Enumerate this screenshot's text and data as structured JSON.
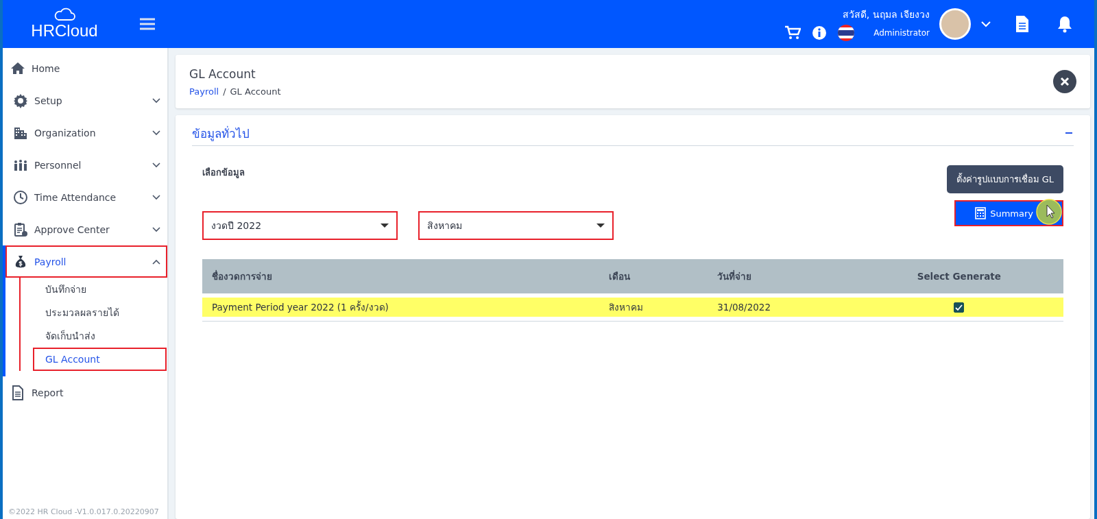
{
  "header": {
    "logo": "HRCloud",
    "greeting": "สวัสดี, นฤมล เจียงวง",
    "role": "Administrator"
  },
  "sidebar": {
    "items": [
      {
        "label": "Home",
        "kind": "link",
        "selected": false,
        "highlighted": false
      },
      {
        "label": "Setup",
        "kind": "group",
        "expanded": false,
        "selected": false,
        "highlighted": false
      },
      {
        "label": "Organization",
        "kind": "group",
        "expanded": false,
        "selected": false,
        "highlighted": false
      },
      {
        "label": "Personnel",
        "kind": "group",
        "expanded": false,
        "selected": false,
        "highlighted": false
      },
      {
        "label": "Time Attendance",
        "kind": "group",
        "expanded": false,
        "selected": false,
        "highlighted": false
      },
      {
        "label": "Approve Center",
        "kind": "group",
        "expanded": false,
        "selected": false,
        "highlighted": false
      },
      {
        "label": "Payroll",
        "kind": "group",
        "expanded": true,
        "selected": true,
        "highlighted": true,
        "children": [
          {
            "label": "บันทึกจ่าย",
            "selected": false,
            "highlighted": false
          },
          {
            "label": "ประมวลผลรายได้",
            "selected": false,
            "highlighted": false
          },
          {
            "label": "จัดเก็บนำส่ง",
            "selected": false,
            "highlighted": false
          },
          {
            "label": "GL Account",
            "selected": true,
            "highlighted": true
          }
        ]
      },
      {
        "label": "Report",
        "kind": "link",
        "selected": false,
        "highlighted": false
      }
    ],
    "footer": "©2022  HR Cloud  -V1.0.017.0.20220907"
  },
  "page": {
    "title": "GL Account",
    "breadcrumb": [
      "Payroll",
      "GL Account"
    ],
    "breadcrumb_separator": "/"
  },
  "section": {
    "title": "ข้อมูลทั่วไป",
    "expanded": true,
    "label": "เลือกข้อมูล",
    "selects": [
      {
        "value": "งวดปี 2022",
        "highlighted": true
      },
      {
        "value": "สิงหาคม",
        "highlighted": true
      }
    ],
    "buttons": [
      {
        "label": "ตั้งค่ารูปแบบการเชื่อม GL",
        "kind": "settings",
        "highlighted": false
      },
      {
        "label": "Summary",
        "kind": "summary",
        "highlighted": true
      }
    ],
    "table": {
      "columns": [
        "ชื่องวดการจ่าย",
        "เดือน",
        "วันที่จ่าย",
        "Select Generate"
      ],
      "rows": [
        {
          "cells": [
            "Payment Period year 2022 (1 ครั้ง/งวด)",
            "สิงหาคม",
            "31/08/2022"
          ],
          "checked": true,
          "highlighted": true
        }
      ]
    }
  }
}
